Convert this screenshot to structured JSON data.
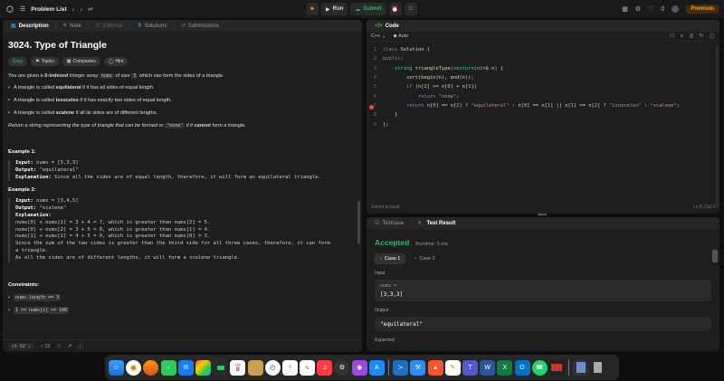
{
  "topbar": {
    "title": "Problem List",
    "run_label": "Run",
    "submit_label": "Submit",
    "streak": "0",
    "premium_label": "Premium"
  },
  "left": {
    "tabs": [
      {
        "label": "Description"
      },
      {
        "label": "Note"
      },
      {
        "label": "Editorial"
      },
      {
        "label": "Solutions"
      },
      {
        "label": "Submissions"
      }
    ],
    "problem_title": "3024. Type of Triangle",
    "badges": [
      "Easy",
      "Topics",
      "Companies",
      "Hint"
    ],
    "intro": {
      "p1": "You are given a ",
      "bold1": "0-indexed",
      "p2": " integer array ",
      "code1": "nums",
      "p3": " of size ",
      "code2": "3",
      "p4": " which can form the sides of a triangle."
    },
    "bullets": [
      {
        "pre": "A triangle is called ",
        "bold": "equilateral",
        "post": " if it has all sides of equal length."
      },
      {
        "pre": "A triangle is called ",
        "bold": "isosceles",
        "post": " if it has exactly two sides of equal length."
      },
      {
        "pre": "A triangle is called ",
        "bold": "scalene",
        "post": " if all its sides are of different lengths."
      }
    ],
    "return_text": {
      "p1": "Return a string representing the type of triangle that can be formed or ",
      "code": "\"none\"",
      "p2": " if it ",
      "bold": "cannot",
      "p3": " form a triangle."
    },
    "example1": {
      "title": "Example 1:",
      "input_label": "Input:",
      "input": " nums = [3,3,3]",
      "output_label": "Output:",
      "output": " \"equilateral\"",
      "expl_label": "Explanation:",
      "expl": " Since all the sides are of equal length, therefore, it will form an equilateral triangle."
    },
    "example2": {
      "title": "Example 2:",
      "input_label": "Input:",
      "input": " nums = [3,4,5]",
      "output_label": "Output:",
      "output": " \"scalene\"",
      "expl_label": "Explanation:",
      "lines": [
        "nums[0] + nums[1] = 3 + 4 = 7, which is greater than nums[2] = 5.",
        "nums[0] + nums[2] = 3 + 5 = 8, which is greater than nums[1] = 4.",
        "nums[1] + nums[2] = 4 + 5 = 9, which is greater than nums[0] = 3.",
        "Since the sum of the two sides is greater than the third side for all three cases, therefore, it can form",
        "a triangle.",
        "As all the sides are of different lengths, it will form a scalene triangle."
      ]
    },
    "constraints_title": "Constraints:",
    "constraints": [
      "nums.length == 3",
      "1 <= nums[i] <= 100"
    ],
    "footer": {
      "likes": "62",
      "comments": "12"
    }
  },
  "code": {
    "tab_label": "Code",
    "language": "C++",
    "autocomplete": "Auto",
    "lines": [
      "class Solution {",
      "public:",
      "    string triangleType(vector<int>& n) {",
      "        sort(begin(n), end(n));",
      "        if (n[2] >= n[0] + n[1])",
      "            return \"none\";",
      "        return n[0] == n[2] ? \"equilateral\" : n[0] == n[1] || n[1] == n[2] ? \"isosceles\" : \"scalene\";",
      "    }",
      "};"
    ],
    "saved": "Saved to local",
    "cursor": "Ln 8, Col 3"
  },
  "result": {
    "tabs": [
      {
        "label": "Testcase"
      },
      {
        "label": "Test Result"
      }
    ],
    "status": "Accepted",
    "runtime": "Runtime: 5 ms",
    "cases": [
      "Case 1",
      "Case 2"
    ],
    "input_label": "Input",
    "input_var": "nums =",
    "input_val": "[3,3,3]",
    "output_label": "Output",
    "output_val": "\"equilateral\"",
    "expected_label": "Expected"
  },
  "dock": {
    "calendar_month": "APR",
    "calendar_day": "8"
  },
  "colors": {
    "accepted": "#2cbb5d",
    "premium": "#ffa116",
    "breakpoint": "#e5484d"
  }
}
